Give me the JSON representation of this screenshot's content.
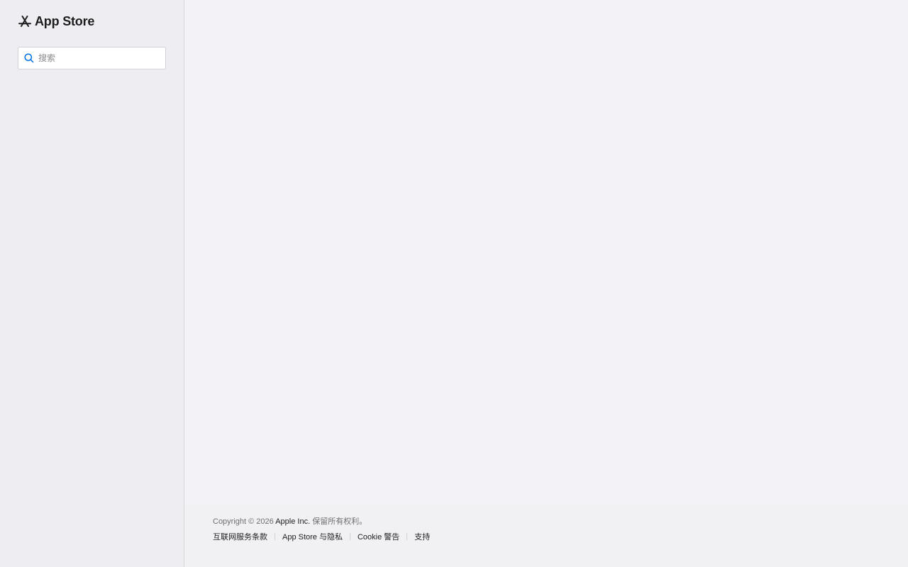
{
  "brand": {
    "title": "App Store",
    "icon": "app-store-icon"
  },
  "search": {
    "placeholder": "搜索",
    "value": "",
    "icon": "search-icon"
  },
  "footer": {
    "copyright_prefix": "Copyright © 2026",
    "company": "Apple Inc.",
    "rights": "保留所有权利。",
    "links": [
      {
        "label": "互联网服务条款"
      },
      {
        "label": "App Store 与隐私"
      },
      {
        "label": "Cookie 警告"
      },
      {
        "label": "支持"
      }
    ]
  },
  "colors": {
    "sidebar_bg": "#eeeef2",
    "main_bg": "#f3f3f7",
    "footer_bg": "#f1f1f3",
    "search_icon": "#0071e3",
    "text": "#1d1d1f",
    "muted_text": "#6e6e73"
  }
}
